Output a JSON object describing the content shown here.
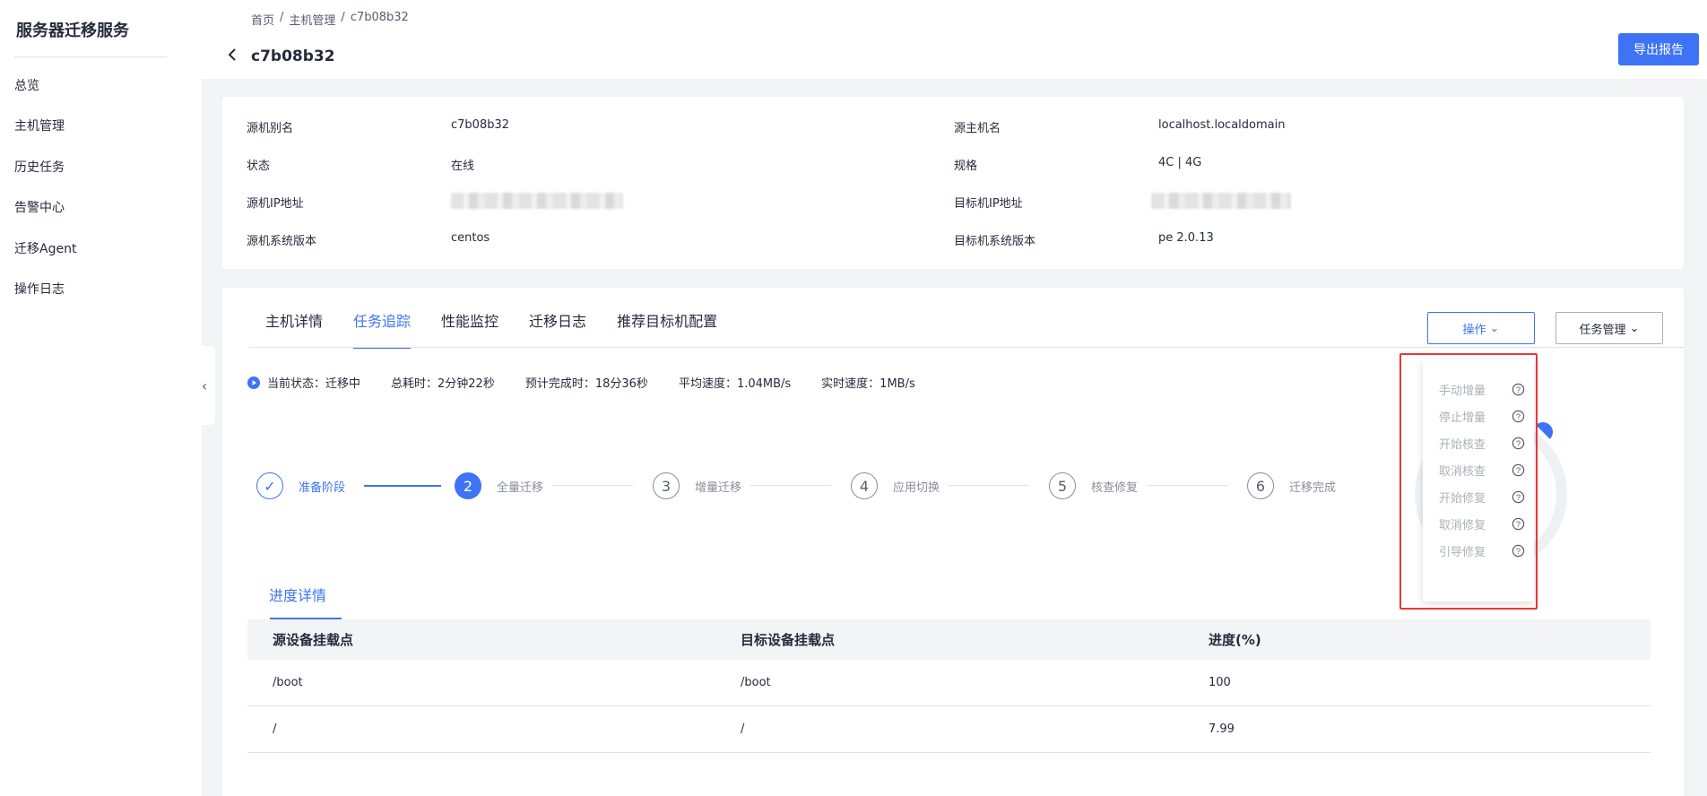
{
  "sidebar": {
    "title": "服务器迁移服务",
    "items": [
      {
        "label": "总览"
      },
      {
        "label": "主机管理"
      },
      {
        "label": "历史任务"
      },
      {
        "label": "告警中心"
      },
      {
        "label": "迁移Agent"
      },
      {
        "label": "操作日志"
      }
    ]
  },
  "header": {
    "breadcrumb": [
      "首页",
      "/",
      "主机管理",
      "/",
      "c7b08b32"
    ],
    "title": "c7b08b32",
    "export_label": "导出报告"
  },
  "info": {
    "source_alias_label": "源机别名",
    "source_alias_value": "c7b08b32",
    "status_label": "状态",
    "status_value": "在线",
    "source_ip_label": "源机IP地址",
    "source_os_label": "源机系统版本",
    "source_os_value": "centos",
    "source_host_label": "源主机名",
    "source_host_value": "localhost.localdomain",
    "spec_label": "规格",
    "spec_value": "4C | 4G",
    "target_ip_label": "目标机IP地址",
    "target_os_label": "目标机系统版本",
    "target_os_value": "pe 2.0.13"
  },
  "tabs": [
    "主机详情",
    "任务追踪",
    "性能监控",
    "迁移日志",
    "推荐目标机配置"
  ],
  "actions": {
    "operation_label": "操作",
    "task_label": "任务管理"
  },
  "status_row": {
    "current": "当前状态：迁移中",
    "elapsed": "总耗时：2分钟22秒",
    "eta": "预计完成时：18分36秒",
    "avg_speed": "平均速度：1.04MB/s",
    "realtime_speed": "实时速度：1MB/s"
  },
  "steps": [
    {
      "num": "✓",
      "label": "准备阶段"
    },
    {
      "num": "2",
      "label": "全量迁移"
    },
    {
      "num": "3",
      "label": "增量迁移"
    },
    {
      "num": "4",
      "label": "应用切换"
    },
    {
      "num": "5",
      "label": "核查修复"
    },
    {
      "num": "6",
      "label": "迁移完成"
    }
  ],
  "dropdown_items": [
    "手动增量",
    "停止增量",
    "开始核查",
    "取消核查",
    "开始修复",
    "取消修复",
    "引导修复"
  ],
  "progress": {
    "tab_label": "进度详情",
    "headers": [
      "源设备挂载点",
      "目标设备挂载点",
      "进度(%)"
    ],
    "rows": [
      [
        "/boot",
        "/boot",
        "100"
      ],
      [
        "/",
        "/",
        "7.99"
      ]
    ]
  },
  "colors": {
    "accent": "#3e73f5",
    "highlight": "#e53935"
  }
}
